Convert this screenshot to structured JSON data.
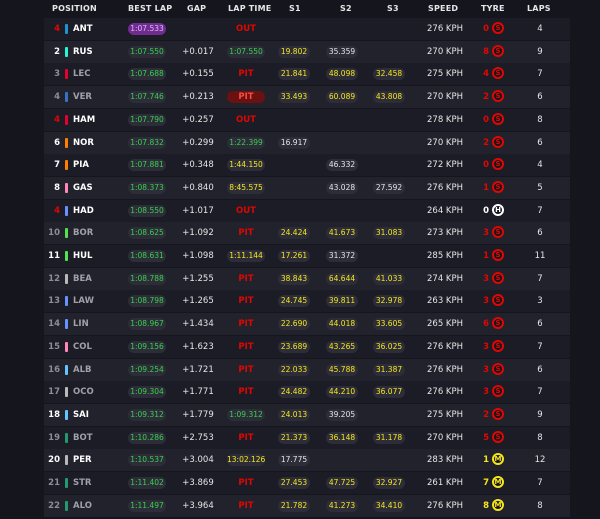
{
  "headers": {
    "position": "POSITION",
    "best_lap": "BEST LAP",
    "gap": "GAP",
    "lap_time": "LAP TIME",
    "s1": "S1",
    "s2": "S2",
    "s3": "S3",
    "speed": "SPEED",
    "tyre": "TYRE",
    "laps": "LAPS"
  },
  "colors": {
    "soft": "#e10600",
    "medium": "#f5e71a",
    "hard": "#ffffff",
    "personal_best": "#37d14a",
    "fastest": "#702c8e",
    "sector_yellow": "#f5e71a"
  },
  "rows": [
    {
      "pos": "4",
      "pos_color": "red",
      "team": "#2293d1",
      "code": "ANT",
      "best": "1:07.533",
      "best_purple": true,
      "gap": "",
      "lap_time": "OUT",
      "lap_kind": "out",
      "s1": "",
      "s1c": "",
      "s2": "",
      "s2c": "",
      "s3": "",
      "s3c": "",
      "speed": "276 KPH",
      "tyre_age": "0",
      "tyre_age_color": "red",
      "tyre": "S",
      "tyre_kind": "soft",
      "laps": "4"
    },
    {
      "pos": "2",
      "pos_color": "white",
      "team": "#27f4d2",
      "code": "RUS",
      "best": "1:07.550",
      "gap": "+0.017",
      "lap_time": "1:07.550",
      "lap_kind": "time",
      "s1": "19.802",
      "s1c": "y",
      "s2": "35.359",
      "s2c": "w",
      "s3": "",
      "s3c": "",
      "speed": "270 KPH",
      "tyre_age": "8",
      "tyre_age_color": "red",
      "tyre": "S",
      "tyre_kind": "soft",
      "laps": "9"
    },
    {
      "pos": "3",
      "pos_color": "grey",
      "team": "#e8002d",
      "code": "LEC",
      "best": "1:07.688",
      "gap": "+0.155",
      "lap_time": "PIT",
      "lap_kind": "pit",
      "s1": "21.841",
      "s1c": "y",
      "s2": "48.098",
      "s2c": "y",
      "s3": "32.458",
      "s3c": "y",
      "speed": "275 KPH",
      "tyre_age": "4",
      "tyre_age_color": "red",
      "tyre": "S",
      "tyre_kind": "soft",
      "laps": "7"
    },
    {
      "pos": "4",
      "pos_color": "grey",
      "team": "#3671c6",
      "code": "VER",
      "best": "1:07.746",
      "gap": "+0.213",
      "lap_time": "PIT",
      "lap_kind": "pitbg",
      "s1": "33.493",
      "s1c": "y",
      "s2": "60.089",
      "s2c": "y",
      "s3": "43.808",
      "s3c": "y",
      "speed": "270 KPH",
      "tyre_age": "2",
      "tyre_age_color": "red",
      "tyre": "S",
      "tyre_kind": "soft",
      "laps": "6"
    },
    {
      "pos": "4",
      "pos_color": "red",
      "team": "#e8002d",
      "code": "HAM",
      "best": "1:07.790",
      "gap": "+0.257",
      "lap_time": "OUT",
      "lap_kind": "out",
      "s1": "",
      "s1c": "",
      "s2": "",
      "s2c": "",
      "s3": "",
      "s3c": "",
      "speed": "278 KPH",
      "tyre_age": "0",
      "tyre_age_color": "red",
      "tyre": "S",
      "tyre_kind": "soft",
      "laps": "8"
    },
    {
      "pos": "6",
      "pos_color": "white",
      "team": "#ff8000",
      "code": "NOR",
      "best": "1:07.832",
      "gap": "+0.299",
      "lap_time": "1:22.399",
      "lap_kind": "time",
      "s1": "16.917",
      "s1c": "w",
      "s2": "",
      "s2c": "",
      "s3": "",
      "s3c": "",
      "speed": "270 KPH",
      "tyre_age": "2",
      "tyre_age_color": "red",
      "tyre": "S",
      "tyre_kind": "soft",
      "laps": "6"
    },
    {
      "pos": "7",
      "pos_color": "white",
      "team": "#ff8000",
      "code": "PIA",
      "best": "1:07.881",
      "gap": "+0.348",
      "lap_time": "1:44.150",
      "lap_kind": "yellow",
      "s1": "",
      "s1c": "",
      "s2": "46.332",
      "s2c": "w",
      "s3": "",
      "s3c": "",
      "speed": "272 KPH",
      "tyre_age": "0",
      "tyre_age_color": "red",
      "tyre": "S",
      "tyre_kind": "soft",
      "laps": "4"
    },
    {
      "pos": "8",
      "pos_color": "white",
      "team": "#ff87bc",
      "code": "GAS",
      "best": "1:08.373",
      "gap": "+0.840",
      "lap_time": "8:45.575",
      "lap_kind": "yellow",
      "s1": "",
      "s1c": "",
      "s2": "43.028",
      "s2c": "w",
      "s3": "27.592",
      "s3c": "w",
      "speed": "276 KPH",
      "tyre_age": "1",
      "tyre_age_color": "red",
      "tyre": "S",
      "tyre_kind": "soft",
      "laps": "5"
    },
    {
      "pos": "4",
      "pos_color": "red",
      "team": "#6692ff",
      "code": "HAD",
      "best": "1:08.550",
      "gap": "+1.017",
      "lap_time": "OUT",
      "lap_kind": "out",
      "s1": "",
      "s1c": "",
      "s2": "",
      "s2c": "",
      "s3": "",
      "s3c": "",
      "speed": "264 KPH",
      "tyre_age": "0",
      "tyre_age_color": "white",
      "tyre": "H",
      "tyre_kind": "hard",
      "laps": "7"
    },
    {
      "pos": "10",
      "pos_color": "grey",
      "team": "#52e252",
      "code": "BOR",
      "best": "1:08.625",
      "gap": "+1.092",
      "lap_time": "PIT",
      "lap_kind": "pit",
      "s1": "24.424",
      "s1c": "y",
      "s2": "41.673",
      "s2c": "y",
      "s3": "31.083",
      "s3c": "y",
      "speed": "273 KPH",
      "tyre_age": "3",
      "tyre_age_color": "red",
      "tyre": "S",
      "tyre_kind": "soft",
      "laps": "6"
    },
    {
      "pos": "11",
      "pos_color": "white",
      "team": "#52e252",
      "code": "HUL",
      "best": "1:08.631",
      "gap": "+1.098",
      "lap_time": "1:11.144",
      "lap_kind": "yellow",
      "s1": "17.261",
      "s1c": "y",
      "s2": "31.372",
      "s2c": "w",
      "s3": "",
      "s3c": "",
      "speed": "285 KPH",
      "tyre_age": "1",
      "tyre_age_color": "red",
      "tyre": "S",
      "tyre_kind": "soft",
      "laps": "11"
    },
    {
      "pos": "12",
      "pos_color": "grey",
      "team": "#b6babd",
      "code": "BEA",
      "best": "1:08.788",
      "gap": "+1.255",
      "lap_time": "PIT",
      "lap_kind": "pit",
      "s1": "38.843",
      "s1c": "y",
      "s2": "64.644",
      "s2c": "y",
      "s3": "41.033",
      "s3c": "y",
      "speed": "274 KPH",
      "tyre_age": "3",
      "tyre_age_color": "red",
      "tyre": "S",
      "tyre_kind": "soft",
      "laps": "7"
    },
    {
      "pos": "13",
      "pos_color": "grey",
      "team": "#6692ff",
      "code": "LAW",
      "best": "1:08.798",
      "gap": "+1.265",
      "lap_time": "PIT",
      "lap_kind": "pit",
      "s1": "24.745",
      "s1c": "y",
      "s2": "39.811",
      "s2c": "y",
      "s3": "32.978",
      "s3c": "y",
      "speed": "263 KPH",
      "tyre_age": "3",
      "tyre_age_color": "red",
      "tyre": "S",
      "tyre_kind": "soft",
      "laps": "3"
    },
    {
      "pos": "14",
      "pos_color": "grey",
      "team": "#6692ff",
      "code": "LIN",
      "best": "1:08.967",
      "gap": "+1.434",
      "lap_time": "PIT",
      "lap_kind": "pit",
      "s1": "22.690",
      "s1c": "y",
      "s2": "44.018",
      "s2c": "y",
      "s3": "33.605",
      "s3c": "y",
      "speed": "265 KPH",
      "tyre_age": "6",
      "tyre_age_color": "red",
      "tyre": "S",
      "tyre_kind": "soft",
      "laps": "6"
    },
    {
      "pos": "15",
      "pos_color": "grey",
      "team": "#ff87bc",
      "code": "COL",
      "best": "1:09.156",
      "gap": "+1.623",
      "lap_time": "PIT",
      "lap_kind": "pit",
      "s1": "23.689",
      "s1c": "y",
      "s2": "43.265",
      "s2c": "y",
      "s3": "36.025",
      "s3c": "y",
      "speed": "276 KPH",
      "tyre_age": "3",
      "tyre_age_color": "red",
      "tyre": "S",
      "tyre_kind": "soft",
      "laps": "7"
    },
    {
      "pos": "16",
      "pos_color": "grey",
      "team": "#64c4ff",
      "code": "ALB",
      "best": "1:09.254",
      "gap": "+1.721",
      "lap_time": "PIT",
      "lap_kind": "pit",
      "s1": "22.033",
      "s1c": "y",
      "s2": "45.788",
      "s2c": "y",
      "s3": "31.387",
      "s3c": "y",
      "speed": "276 KPH",
      "tyre_age": "3",
      "tyre_age_color": "red",
      "tyre": "S",
      "tyre_kind": "soft",
      "laps": "6"
    },
    {
      "pos": "17",
      "pos_color": "grey",
      "team": "#b6babd",
      "code": "OCO",
      "best": "1:09.304",
      "gap": "+1.771",
      "lap_time": "PIT",
      "lap_kind": "pit",
      "s1": "24.482",
      "s1c": "y",
      "s2": "44.210",
      "s2c": "y",
      "s3": "36.077",
      "s3c": "y",
      "speed": "276 KPH",
      "tyre_age": "3",
      "tyre_age_color": "red",
      "tyre": "S",
      "tyre_kind": "soft",
      "laps": "7"
    },
    {
      "pos": "18",
      "pos_color": "white",
      "team": "#64c4ff",
      "code": "SAI",
      "best": "1:09.312",
      "gap": "+1.779",
      "lap_time": "1:09.312",
      "lap_kind": "time",
      "s1": "24.013",
      "s1c": "y",
      "s2": "39.205",
      "s2c": "w",
      "s3": "",
      "s3c": "",
      "speed": "275 KPH",
      "tyre_age": "2",
      "tyre_age_color": "red",
      "tyre": "S",
      "tyre_kind": "soft",
      "laps": "9"
    },
    {
      "pos": "19",
      "pos_color": "grey",
      "team": "#229971",
      "code": "BOT",
      "best": "1:10.286",
      "gap": "+2.753",
      "lap_time": "PIT",
      "lap_kind": "pit",
      "s1": "21.373",
      "s1c": "y",
      "s2": "36.148",
      "s2c": "y",
      "s3": "31.178",
      "s3c": "y",
      "speed": "270 KPH",
      "tyre_age": "5",
      "tyre_age_color": "red",
      "tyre": "S",
      "tyre_kind": "soft",
      "laps": "8"
    },
    {
      "pos": "20",
      "pos_color": "white",
      "team": "#b6babd",
      "code": "PER",
      "best": "1:10.537",
      "gap": "+3.004",
      "lap_time": "13:02.126",
      "lap_kind": "yellow",
      "s1": "17.775",
      "s1c": "w",
      "s2": "",
      "s2c": "",
      "s3": "",
      "s3c": "",
      "speed": "283 KPH",
      "tyre_age": "1",
      "tyre_age_color": "yellow",
      "tyre": "M",
      "tyre_kind": "medium",
      "laps": "12"
    },
    {
      "pos": "21",
      "pos_color": "grey",
      "team": "#229971",
      "code": "STR",
      "best": "1:11.402",
      "gap": "+3.869",
      "lap_time": "PIT",
      "lap_kind": "pit",
      "s1": "27.453",
      "s1c": "y",
      "s2": "47.725",
      "s2c": "y",
      "s3": "32.927",
      "s3c": "y",
      "speed": "261 KPH",
      "tyre_age": "7",
      "tyre_age_color": "yellow",
      "tyre": "M",
      "tyre_kind": "medium",
      "laps": "7"
    },
    {
      "pos": "22",
      "pos_color": "grey",
      "team": "#229971",
      "code": "ALO",
      "best": "1:11.497",
      "gap": "+3.964",
      "lap_time": "PIT",
      "lap_kind": "pit",
      "s1": "21.782",
      "s1c": "y",
      "s2": "41.273",
      "s2c": "y",
      "s3": "34.410",
      "s3c": "y",
      "speed": "276 KPH",
      "tyre_age": "8",
      "tyre_age_color": "yellow",
      "tyre": "M",
      "tyre_kind": "medium",
      "laps": "8"
    }
  ]
}
